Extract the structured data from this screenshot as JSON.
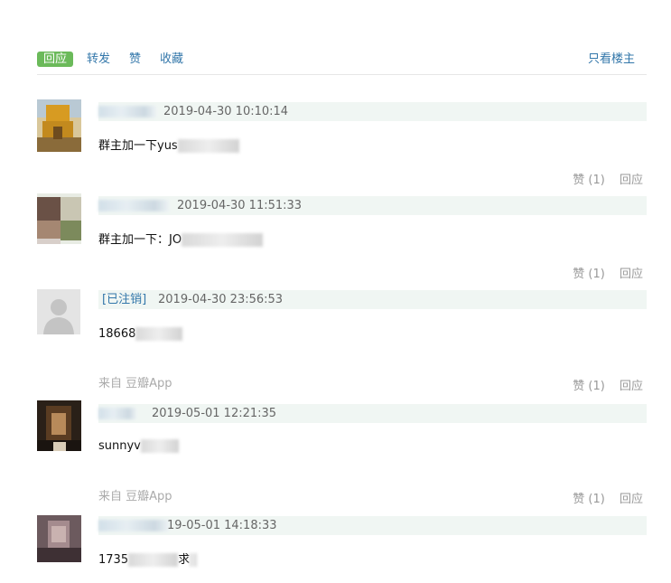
{
  "tabs": {
    "reply": "回应",
    "repost": "转发",
    "like": "赞",
    "collect": "收藏",
    "only_author": "只看楼主"
  },
  "comments": [
    {
      "name": "",
      "time": "2019-04-30 10:10:14",
      "content_visible": "群主加一下yus",
      "source": "",
      "like": "赞 (1)",
      "reply": "回应"
    },
    {
      "name": "",
      "time": "2019-04-30 11:51:33",
      "content_visible": "群主加一下：JO",
      "source": "",
      "like": "赞 (1)",
      "reply": "回应"
    },
    {
      "name": "[已注销]",
      "time": "2019-04-30 23:56:53",
      "content_visible": "18668",
      "source": "来自 豆瓣App",
      "like": "赞 (1)",
      "reply": "回应"
    },
    {
      "name": "",
      "time": "2019-05-01 12:21:35",
      "content_visible": "sunnyv",
      "source": "来自 豆瓣App",
      "like": "赞 (1)",
      "reply": "回应"
    },
    {
      "name": "",
      "time": "19-05-01 14:18:33",
      "content_visible": "1735",
      "content_tail": "求",
      "source": "",
      "like": "",
      "reply": ""
    }
  ]
}
